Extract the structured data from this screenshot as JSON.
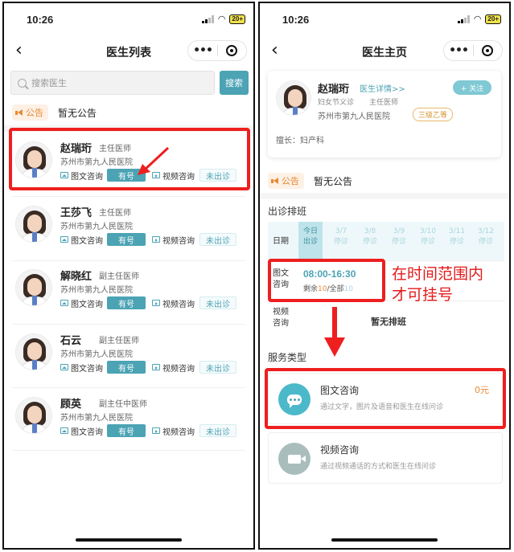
{
  "status": {
    "time": "10:26",
    "battery": "20+"
  },
  "left": {
    "title": "医生列表",
    "search": {
      "placeholder": "搜索医生",
      "button": "搜索"
    },
    "notice": {
      "tag": "公告",
      "text": "暂无公告"
    },
    "doctors": [
      {
        "name": "赵瑞珩",
        "title": "主任医师",
        "hospital": "苏州市第九人民医院",
        "svc_text": "图文咨询",
        "svc_text_status": "有号",
        "svc_video": "视频咨询",
        "svc_video_status": "未出诊"
      },
      {
        "name": "王莎飞",
        "title": "主任医师",
        "hospital": "苏州市第九人民医院",
        "svc_text": "图文咨询",
        "svc_text_status": "有号",
        "svc_video": "视频咨询",
        "svc_video_status": "未出诊"
      },
      {
        "name": "解晓红",
        "title": "副主任医师",
        "hospital": "苏州市第九人民医院",
        "svc_text": "图文咨询",
        "svc_text_status": "有号",
        "svc_video": "视频咨询",
        "svc_video_status": "未出诊"
      },
      {
        "name": "石云",
        "title": "副主任医师",
        "hospital": "苏州市第九人民医院",
        "svc_text": "图文咨询",
        "svc_text_status": "有号",
        "svc_video": "视频咨询",
        "svc_video_status": "未出诊"
      },
      {
        "name": "顾英",
        "title": "副主任中医师",
        "hospital": "苏州市第九人民医院",
        "svc_text": "图文咨询",
        "svc_text_status": "有号",
        "svc_video": "视频咨询",
        "svc_video_status": "未出诊"
      }
    ]
  },
  "right": {
    "title": "医生主页",
    "doctor": {
      "name": "赵瑞珩",
      "detail_link": "医生详情>>",
      "follow": "+ 关注",
      "dept": "妇女节义诊",
      "title": "主任医师",
      "hospital": "苏州市第九人民医院",
      "grade": "三级乙等",
      "specialty": "擅长：妇产科"
    },
    "notice": {
      "tag": "公告",
      "text": "暂无公告"
    },
    "schedule": {
      "section": "出诊排班",
      "date_label": "日期",
      "days": [
        {
          "date": "今日",
          "status": "出诊"
        },
        {
          "date": "3/7",
          "status": "停诊"
        },
        {
          "date": "3/8",
          "status": "停诊"
        },
        {
          "date": "3/9",
          "status": "停诊"
        },
        {
          "date": "3/10",
          "status": "停诊"
        },
        {
          "date": "3/11",
          "status": "停诊"
        },
        {
          "date": "3/12",
          "status": "停诊"
        }
      ],
      "text_row": {
        "label1": "图文",
        "label2": "咨询",
        "time": "08:00-16:30",
        "remain_prefix": "剩余",
        "remain_value": "10",
        "total_prefix": "/全部",
        "total_value": "10"
      },
      "video_row": {
        "label1": "视频",
        "label2": "咨询",
        "none": "暂无排班"
      }
    },
    "annotation": [
      "在时间范围内",
      "才可挂号"
    ],
    "services_section": "服务类型",
    "services": [
      {
        "title": "图文咨询",
        "desc": "通过文字，图片及语音和医生在线问诊",
        "price": "0元",
        "icon": "chat-bubble-icon",
        "color": "#4bb9c9"
      },
      {
        "title": "视频咨询",
        "desc": "通过视频通话的方式和医生在线问诊",
        "price": "",
        "icon": "video-camera-icon",
        "color": "#a9bdbc"
      }
    ]
  },
  "colors": {
    "accent": "#4ba3b4",
    "highlight": "#ee1f1f",
    "notice": "#e88a33"
  }
}
